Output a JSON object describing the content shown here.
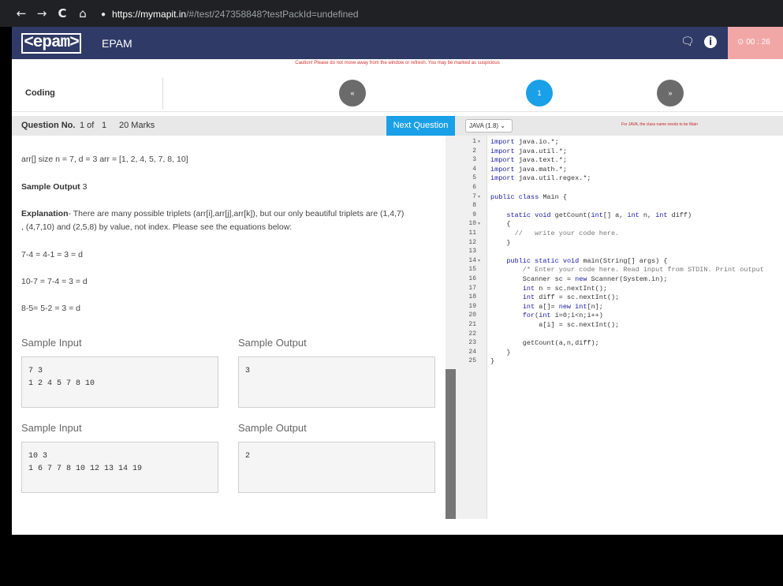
{
  "browser": {
    "back": "←",
    "forward": "→",
    "reload": "C",
    "home": "⌂",
    "lock": "🔒",
    "url_host": "https://mymapit.in",
    "url_path": "/#/test/247358848?testPackId=undefined"
  },
  "header": {
    "logo": "<epam>",
    "brand": "EPAM",
    "chat_icon": "chat-icon",
    "info_icon": "i",
    "timer": "⊙ 00 : 26"
  },
  "caution": "Caution! Please do not move away from the window or refresh. You may be marked as suspicious",
  "section": {
    "label": "Coding",
    "prev": "«",
    "current": "1",
    "next": "»"
  },
  "question_bar": {
    "label": "Question No.",
    "position": "1 of",
    "total": "1",
    "marks": "20 Marks",
    "next_button": "Next Question"
  },
  "content": {
    "line1": "arr[] size n = 7, d = 3 arr = [1, 2, 4, 5, 7, 8, 10]",
    "sample_output_label": "Sample Output",
    "sample_output_value": " 3",
    "explanation_label": "Explanation",
    "explanation_text": "- There are many possible triplets (arr[i],arr[j],arr[k]), but our only beautiful triplets are (1,4,7)",
    "explanation_text2": ", (4,7,10) and (2,5,8) by value, not index. Please see the equations below:",
    "eq1": "7-4 = 4-1 = 3 = d",
    "eq2": "10-7 = 7-4 = 3 = d",
    "eq3": "8-5= 5-2 = 3 = d"
  },
  "samples": [
    {
      "input_label": "Sample Input",
      "output_label": "Sample Output",
      "input": "7 3\n1 2 4 5 7 8 10",
      "output": "3"
    },
    {
      "input_label": "Sample Input",
      "output_label": "Sample Output",
      "input": "10 3\n1 6 7 7 8 10 12 13 14 19",
      "output": "2"
    }
  ],
  "editor": {
    "language": "JAVA (1.8)",
    "note": "For JAVA, the class name needs to be Main",
    "lines": [
      "import java.io.*;",
      "import java.util.*;",
      "import java.text.*;",
      "import java.math.*;",
      "import java.util.regex.*;",
      "",
      "public class Main {",
      "",
      "    static void getCount(int[] a, int n, int diff)",
      "    {",
      "      //   write your code here.",
      "    }",
      "",
      "    public static void main(String[] args) {",
      "        /* Enter your code here. Read input from STDIN. Print output",
      "        Scanner sc = new Scanner(System.in);",
      "        int n = sc.nextInt();",
      "        int diff = sc.nextInt();",
      "        int a[]= new int[n];",
      "        for(int i=0;i<n;i++)",
      "            a[i] = sc.nextInt();",
      "",
      "        getCount(a,n,diff);",
      "    }",
      "}"
    ],
    "fold_lines": [
      1,
      7,
      10,
      14
    ]
  }
}
